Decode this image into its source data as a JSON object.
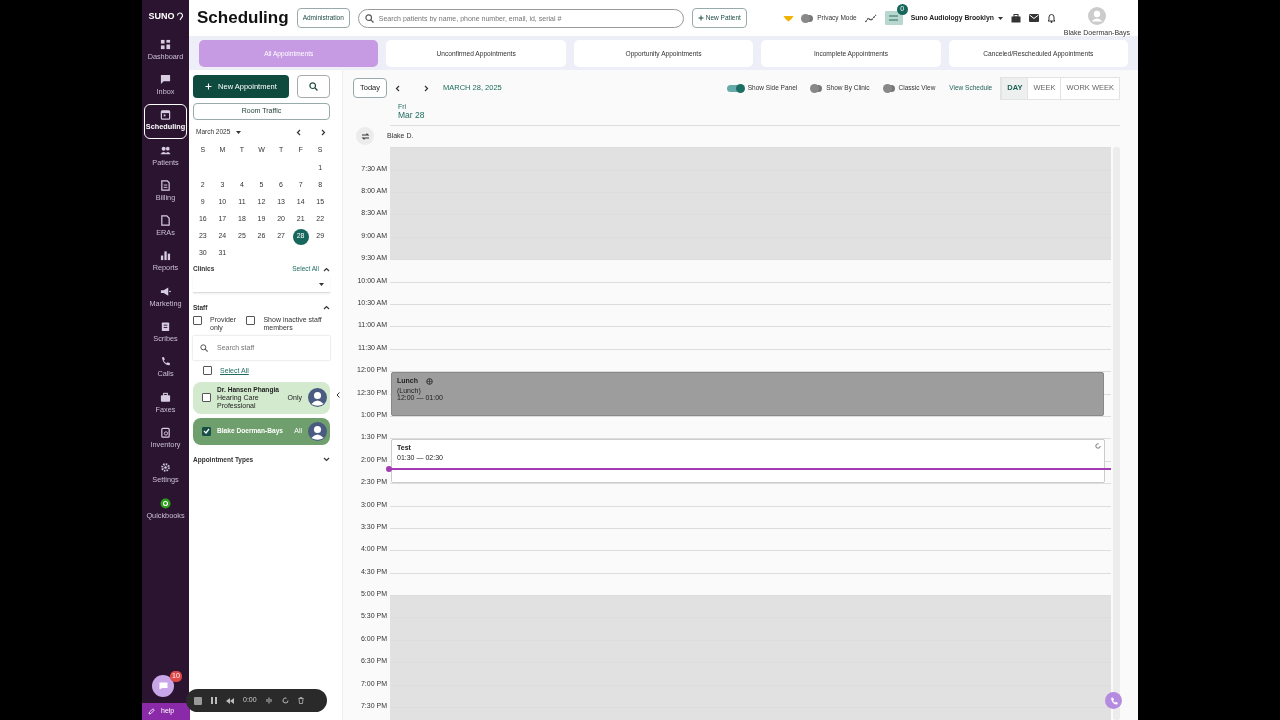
{
  "logo": "SUNO",
  "sidebar": {
    "items": [
      {
        "label": "Dashboard",
        "selected": false
      },
      {
        "label": "Inbox",
        "selected": false
      },
      {
        "label": "Scheduling",
        "selected": true
      },
      {
        "label": "Patients",
        "selected": false
      },
      {
        "label": "Billing",
        "selected": false
      },
      {
        "label": "ERAs",
        "selected": false
      },
      {
        "label": "Reports",
        "selected": false
      },
      {
        "label": "Marketing",
        "selected": false
      },
      {
        "label": "Scribes",
        "selected": false
      },
      {
        "label": "Calls",
        "selected": false
      },
      {
        "label": "Faxes",
        "selected": false
      },
      {
        "label": "Inventory",
        "selected": false
      },
      {
        "label": "Settings",
        "selected": false
      },
      {
        "label": "Quickbooks",
        "selected": false
      }
    ]
  },
  "header": {
    "title": "Scheduling",
    "admin_button": "Administration",
    "search": {
      "placeholder": "Search patients by name, phone number, email, id, serial #"
    },
    "new_patient_button": "New Patient",
    "privacy_mode": {
      "label": "Privacy Mode",
      "on": false
    },
    "tasks_badge": "0",
    "clinic": "Suno Audiology Brooklyn",
    "user": "Blake Doerman-Bays"
  },
  "tabs": [
    {
      "label": "All Appointments",
      "selected": true
    },
    {
      "label": "Unconfirmed Appointments",
      "selected": false
    },
    {
      "label": "Opportunity Appointments",
      "selected": false
    },
    {
      "label": "Incomplete Appointments",
      "selected": false
    },
    {
      "label": "Canceled/Rescheduled Appointments",
      "selected": false
    }
  ],
  "side_panel": {
    "new_appointment_button": "New Appointment",
    "room_traffic_button": "Room Traffic",
    "mini_calendar": {
      "month": "March 2025",
      "weekdays": [
        "S",
        "M",
        "T",
        "W",
        "T",
        "F",
        "S"
      ],
      "weeks": [
        [
          {
            "day": "1",
            "selected": false
          }
        ],
        [
          {
            "day": "2",
            "selected": false
          },
          {
            "day": "3",
            "selected": false
          },
          {
            "day": "4",
            "selected": false
          },
          {
            "day": "5",
            "selected": false
          },
          {
            "day": "6",
            "selected": false
          },
          {
            "day": "7",
            "selected": false
          },
          {
            "day": "8",
            "selected": false
          }
        ],
        [
          {
            "day": "9",
            "selected": false
          },
          {
            "day": "10",
            "selected": false
          },
          {
            "day": "11",
            "selected": false
          },
          {
            "day": "12",
            "selected": false
          },
          {
            "day": "13",
            "selected": false
          },
          {
            "day": "14",
            "selected": false
          },
          {
            "day": "15",
            "selected": false
          }
        ],
        [
          {
            "day": "16",
            "selected": false
          },
          {
            "day": "17",
            "selected": false
          },
          {
            "day": "18",
            "selected": false
          },
          {
            "day": "19",
            "selected": false
          },
          {
            "day": "20",
            "selected": false
          },
          {
            "day": "21",
            "selected": false
          },
          {
            "day": "22",
            "selected": false
          }
        ],
        [
          {
            "day": "23",
            "selected": false
          },
          {
            "day": "24",
            "selected": false
          },
          {
            "day": "25",
            "selected": false
          },
          {
            "day": "26",
            "selected": false
          },
          {
            "day": "27",
            "selected": false
          },
          {
            "day": "28",
            "selected": true
          },
          {
            "day": "29",
            "selected": false
          }
        ],
        [
          {
            "day": "30",
            "selected": false
          },
          {
            "day": "31",
            "selected": false
          }
        ]
      ]
    },
    "clinics": {
      "label": "Clinics",
      "select_all": "Select All",
      "expanded": true
    },
    "staff": {
      "label": "Staff",
      "expanded": true,
      "options": [
        {
          "label": "Provider only",
          "checked": false
        },
        {
          "label": "Show inactive staff members",
          "checked": false
        }
      ],
      "search": {
        "placeholder": "Search staff"
      },
      "select_all": {
        "label": "Select All",
        "checked": false
      },
      "members": [
        {
          "name": "Dr. Hansen Phangia",
          "role": "Hearing Care Professional",
          "scope": "Only",
          "checked": false
        },
        {
          "name": "Blake Doerman-Bays",
          "scope": "All",
          "checked": true
        }
      ]
    },
    "appointment_types": {
      "label": "Appointment Types",
      "expanded": false
    }
  },
  "calendar": {
    "today_button": "Today",
    "date": "MARCH 28, 2025",
    "toggles": [
      {
        "label": "Show Side Panel",
        "on": true
      },
      {
        "label": "Show By Clinic",
        "on": false
      },
      {
        "label": "Classic View",
        "on": false
      }
    ],
    "view_schedule": "View Schedule",
    "views": [
      {
        "label": "DAY",
        "selected": true
      },
      {
        "label": "WEEK",
        "selected": false
      },
      {
        "label": "WORK WEEK",
        "selected": false
      }
    ],
    "day_name": "Fri",
    "day": "Mar 28",
    "provider": "Blake D.",
    "slots": [
      {
        "shaded": true
      },
      {
        "label": "7:30 AM",
        "shaded": true
      },
      {
        "label": "8:00 AM",
        "shaded": true
      },
      {
        "label": "8:30 AM",
        "shaded": true
      },
      {
        "label": "9:00 AM",
        "shaded": true
      },
      {
        "label": "9:30 AM",
        "shaded": false
      },
      {
        "label": "10:00 AM",
        "shaded": false
      },
      {
        "label": "10:30 AM",
        "shaded": false
      },
      {
        "label": "11:00 AM",
        "shaded": false
      },
      {
        "label": "11:30 AM",
        "shaded": false
      },
      {
        "label": "12:00 PM",
        "events": [
          {
            "kind": "block",
            "title": "Lunch",
            "subtitle": "(Lunch)",
            "time": "12:00 — 01:00"
          }
        ]
      },
      {
        "label": "12:30 PM"
      },
      {
        "label": "1:00 PM",
        "shaded": false
      },
      {
        "label": "1:30 PM",
        "events": [
          {
            "kind": "appointment",
            "title": "Test",
            "time": "01:30 — 02:30"
          }
        ]
      },
      {
        "label": "2:00 PM",
        "now": true
      },
      {
        "label": "2:30 PM",
        "shaded": false
      },
      {
        "label": "3:00 PM",
        "shaded": false
      },
      {
        "label": "3:30 PM",
        "shaded": false
      },
      {
        "label": "4:00 PM",
        "shaded": false
      },
      {
        "label": "4:30 PM",
        "shaded": false
      },
      {
        "label": "5:00 PM",
        "shaded": true
      },
      {
        "label": "5:30 PM",
        "shaded": true
      },
      {
        "label": "6:00 PM",
        "shaded": true
      },
      {
        "label": "6:30 PM",
        "shaded": true
      },
      {
        "label": "7:00 PM",
        "shaded": true
      },
      {
        "label": "7:30 PM",
        "shaded": true
      }
    ]
  },
  "chat_badge": "10",
  "help_button": "help",
  "recorder": {
    "time": "0:00"
  }
}
